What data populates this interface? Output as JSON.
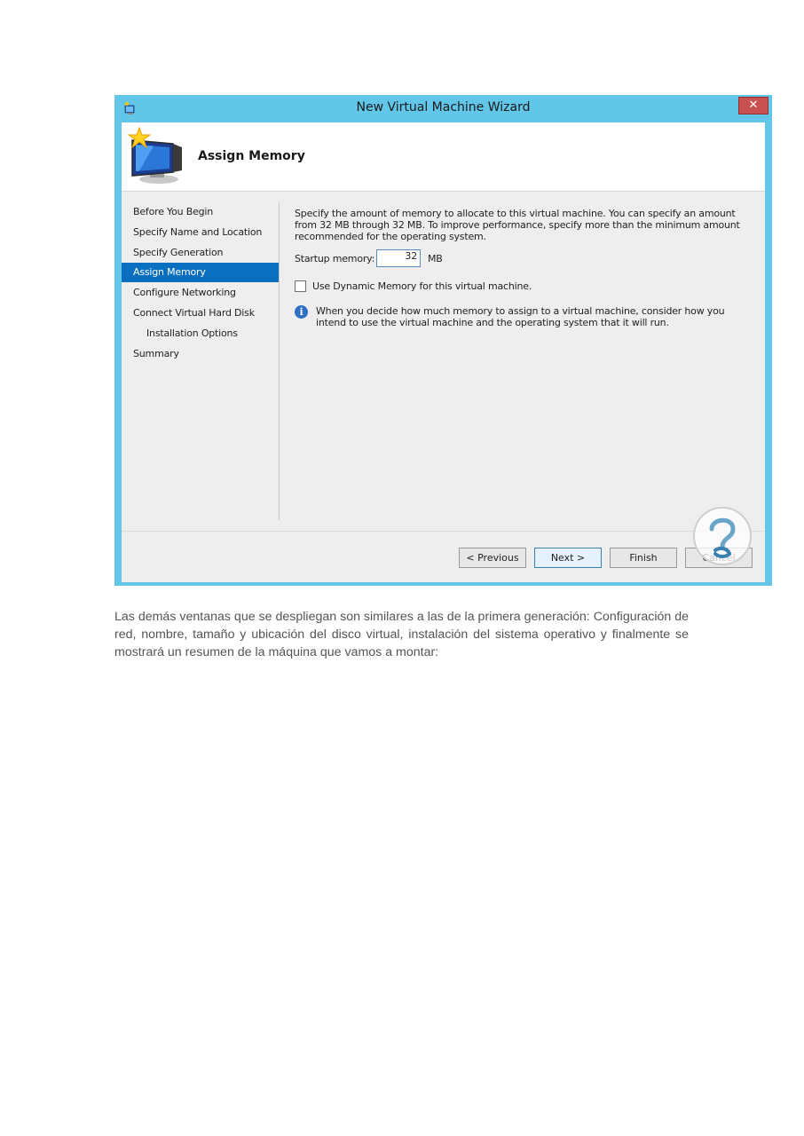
{
  "window": {
    "title": "New Virtual Machine Wizard",
    "close_glyph": "✕",
    "header_title": "Assign Memory"
  },
  "nav": {
    "items": [
      {
        "label": "Before You Begin",
        "selected": false,
        "indent": false
      },
      {
        "label": "Specify Name and Location",
        "selected": false,
        "indent": false
      },
      {
        "label": "Specify Generation",
        "selected": false,
        "indent": false
      },
      {
        "label": "Assign Memory",
        "selected": true,
        "indent": false
      },
      {
        "label": "Configure Networking",
        "selected": false,
        "indent": false
      },
      {
        "label": "Connect Virtual Hard Disk",
        "selected": false,
        "indent": false
      },
      {
        "label": "Installation Options",
        "selected": false,
        "indent": true
      },
      {
        "label": "Summary",
        "selected": false,
        "indent": false
      }
    ]
  },
  "content": {
    "description": "Specify the amount of memory to allocate to this virtual machine. You can specify an amount from 32 MB through 32 MB. To improve performance, specify more than the minimum amount recommended for the operating system.",
    "startup_memory_label": "Startup memory:",
    "startup_memory_value": "32",
    "startup_memory_unit": "MB",
    "dynamic_memory_label": "Use Dynamic Memory for this virtual machine.",
    "dynamic_memory_checked": false,
    "info_glyph": "i",
    "info_text": "When you decide how much memory to assign to a virtual machine, consider how you intend to use the virtual machine and the operating system that it will run."
  },
  "buttons": {
    "previous": "< Previous",
    "next": "Next >",
    "finish": "Finish",
    "cancel": "Cancel"
  },
  "colors": {
    "window_frame": "#61c6e8",
    "selected_nav": "#0b6fbf",
    "close_button": "#c75050"
  },
  "icons": {
    "app": "hyper-v-icon",
    "header": "virtual-machine-wizard-icon",
    "info": "info-icon",
    "watermark": "watermark-logo"
  },
  "document": {
    "paragraph": "Las demás ventanas que se despliegan son similares a las de la primera generación: Configuración de red, nombre, tamaño y ubicación del disco virtual, instalación del sistema operativo y finalmente se mostrará un resumen de la máquina que vamos a montar:"
  }
}
